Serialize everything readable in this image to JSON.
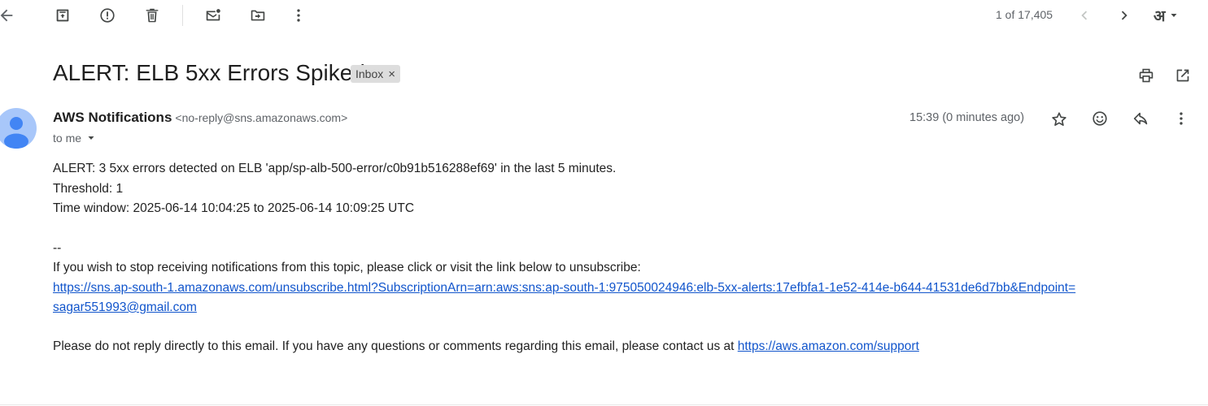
{
  "toolbar": {
    "pager_text": "1 of 17,405",
    "language_glyph": "अ"
  },
  "email": {
    "subject": "ALERT: ELB 5xx Errors Spiked",
    "label": "Inbox",
    "label_remove": "×",
    "sender_name": "AWS Notifications",
    "sender_email": "<no-reply@sns.amazonaws.com>",
    "recipient": "to me",
    "timestamp": "15:39 (0 minutes ago)",
    "body": {
      "line1": "ALERT: 3 5xx errors detected on ELB 'app/sp-alb-500-error/c0b91b516288ef69' in the last 5 minutes.",
      "line2": "Threshold: 1",
      "line3": "Time window: 2025-06-14 10:04:25 to 2025-06-14 10:09:25 UTC",
      "signature_sep": "--",
      "unsubscribe_text": "If you wish to stop receiving notifications from this topic, please click or visit the link below to unsubscribe:",
      "unsubscribe_link_part1": "https://sns.ap-south-1.amazonaws.com/unsubscribe.html?SubscriptionArn=arn:aws:sns:ap-south-1:975050024946:elb-5xx-alerts:17efbfa1-1e52-414e-b644-41531de6d7bb&Endpoint=",
      "unsubscribe_link_part2": "sagar551993@gmail.com",
      "footer_text": "Please do not reply directly to this email. If you have any questions or comments regarding this email, please contact us at ",
      "support_link": "https://aws.amazon.com/support"
    }
  },
  "icons": {
    "back": "arrow-back-icon",
    "archive": "archive-icon",
    "spam": "report-spam-icon",
    "delete": "delete-icon",
    "mark_unread": "mark-unread-icon",
    "move": "move-to-icon",
    "more": "more-vert-icon",
    "prev": "chevron-left-icon",
    "next": "chevron-right-icon",
    "language": "input-tools-icon",
    "print": "print-icon",
    "open_new": "open-in-new-icon",
    "star": "star-icon",
    "emoji": "emoji-icon",
    "reply": "reply-icon"
  },
  "colors": {
    "link": "#1155cc",
    "avatar_bg": "#a8c7fa",
    "avatar_fg": "#4285f4",
    "label_chip_bg": "#dddddd",
    "muted_text": "#5f6368"
  }
}
